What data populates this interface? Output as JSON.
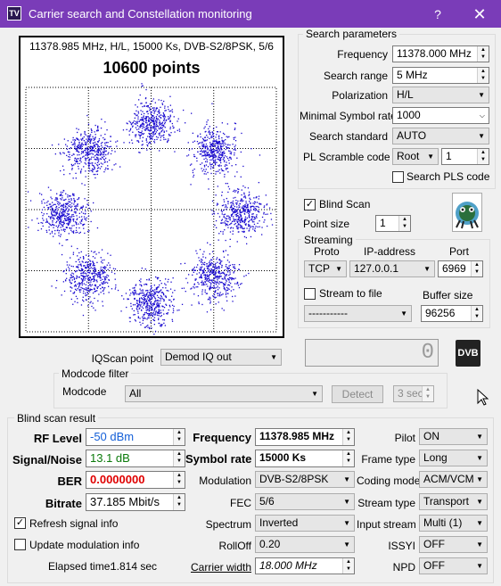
{
  "window": {
    "title": "Carrier search and Constellation monitoring",
    "help": "?",
    "close": "✕"
  },
  "plot": {
    "caption": "11378.985 MHz, H/L, 15000 Ks, DVB-S2/8PSK, 5/6",
    "points_text": "10600 points",
    "dot_color": "#1a0ad0",
    "clusters": [
      [
        0.7071,
        0.7071
      ],
      [
        1.0,
        0.0
      ],
      [
        0.7071,
        -0.7071
      ],
      [
        0.0,
        -1.0
      ],
      [
        -0.7071,
        -0.7071
      ],
      [
        -1.0,
        0.0
      ],
      [
        -0.7071,
        0.7071
      ],
      [
        0.0,
        1.0
      ]
    ]
  },
  "iqscan": {
    "label": "IQScan point",
    "value": "Demod IQ out"
  },
  "modcode_filter": {
    "title": "Modcode filter",
    "label": "Modcode",
    "value": "All",
    "detect": "Detect",
    "seconds": "3 sec"
  },
  "search": {
    "title": "Search parameters",
    "frequency_label": "Frequency",
    "frequency": "11378.000 MHz",
    "range_label": "Search range",
    "range": "5 MHz",
    "polarization_label": "Polarization",
    "polarization": "H/L",
    "min_sr_label": "Minimal Symbol rate",
    "min_sr": "1000",
    "standard_label": "Search standard",
    "standard": "AUTO",
    "pl_label": "PL Scramble code",
    "pl_mode": "Root",
    "pl_value": "1",
    "pls_label": "Search PLS code"
  },
  "blind_scan": {
    "label": "Blind Scan",
    "point_size_label": "Point size",
    "point_size": "1"
  },
  "streaming": {
    "title": "Streaming",
    "proto_label": "Proto",
    "ip_label": "IP-address",
    "port_label": "Port",
    "proto": "TCP",
    "ip": "127.0.0.1",
    "port": "6969",
    "to_file_label": "Stream to file",
    "file": "-----------",
    "buffer_label": "Buffer size",
    "buffer": "96256"
  },
  "lcd": {
    "value": "0"
  },
  "logo": {
    "text": "DVB"
  },
  "result": {
    "title": "Blind scan result",
    "rf_label": "RF Level",
    "rf": "-50 dBm",
    "rf_color": "#1560d8",
    "snr_label": "Signal/Noise",
    "snr": "13.1 dB",
    "snr_color": "#0b7a0b",
    "ber_label": "BER",
    "ber": "0.0000000",
    "ber_color": "#e00000",
    "bitrate_label": "Bitrate",
    "bitrate": "37.185 Mbit/s",
    "refresh_label": "Refresh signal info",
    "update_label": "Update modulation info",
    "elapsed_label": "Elapsed time:",
    "elapsed": "1.814 sec",
    "freq_label": "Frequency",
    "freq": "11378.985 MHz",
    "sr_label": "Symbol rate",
    "sr": "15000 Ks",
    "mod_label": "Modulation",
    "mod": "DVB-S2/8PSK",
    "fec_label": "FEC",
    "fec": "5/6",
    "spectrum_label": "Spectrum",
    "spectrum": "Inverted",
    "rolloff_label": "RollOff",
    "rolloff": "0.20",
    "cw_label": "Carrier width",
    "cw": "18.000 MHz",
    "pilot_label": "Pilot",
    "pilot": "ON",
    "frame_label": "Frame type",
    "frame": "Long",
    "coding_label": "Coding mode",
    "coding": "ACM/VCM",
    "stream_type_label": "Stream type",
    "stream_type": "Transport",
    "input_label": "Input stream",
    "input": "Multi (1)",
    "issyi_label": "ISSYI",
    "issyi": "OFF",
    "npd_label": "NPD",
    "npd": "OFF"
  }
}
